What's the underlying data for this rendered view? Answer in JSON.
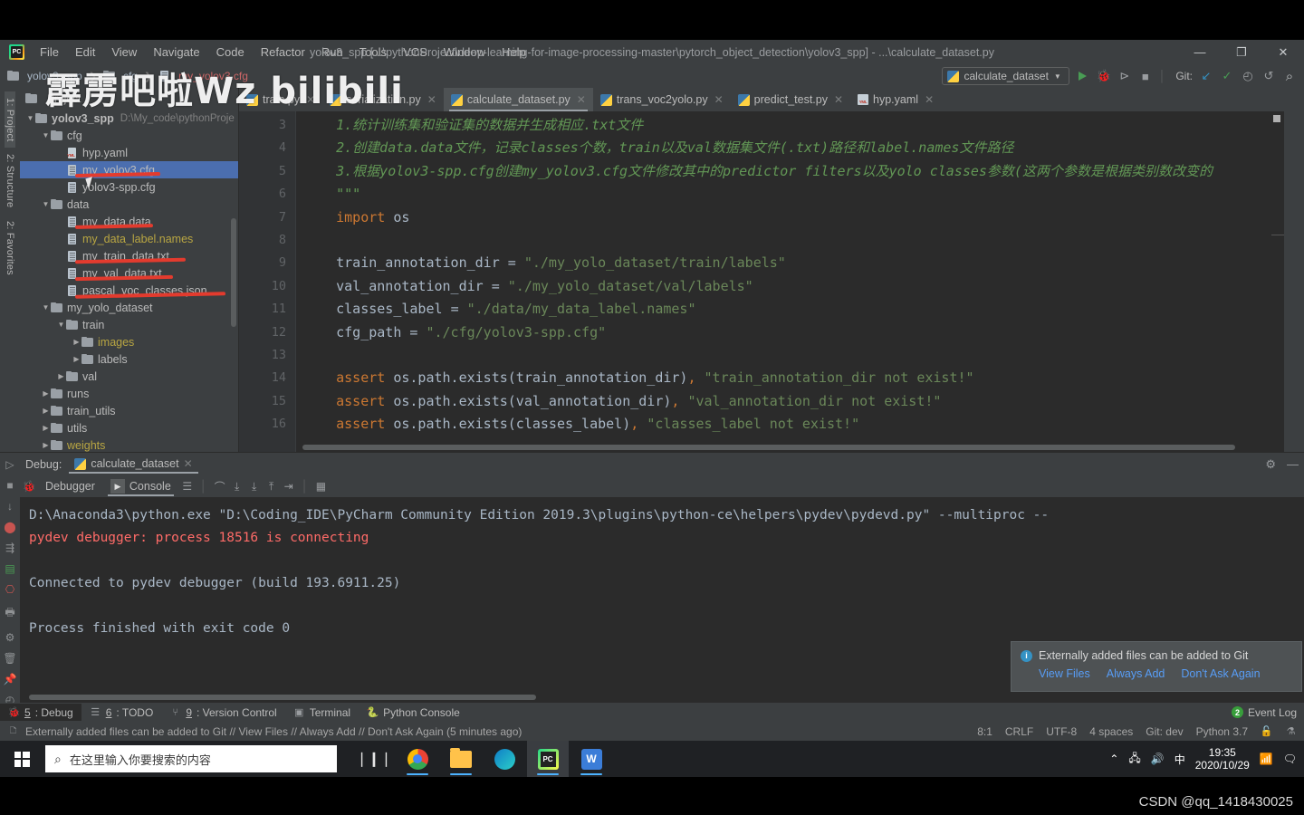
{
  "window": {
    "title": "yolov3_spp [...\\pythonProject\\deep-learning-for-image-processing-master\\pytorch_object_detection\\yolov3_spp] - ...\\calculate_dataset.py",
    "minimize": "—",
    "maximize": "❐",
    "close": "✕"
  },
  "menu": [
    "File",
    "Edit",
    "View",
    "Navigate",
    "Code",
    "Refactor",
    "Run",
    "Tools",
    "VCS",
    "Window",
    "Help"
  ],
  "breadcrumb": {
    "root": "yolov3_spp",
    "folder": "cfg",
    "file": "my_yolov3.cfg"
  },
  "toolbar": {
    "run_config": "calculate_dataset",
    "git_label": "Git:",
    "icons": [
      "run-icon",
      "debug-icon",
      "run-with-coverage-icon",
      "stop-icon",
      "git-update-icon",
      "git-commit-icon",
      "git-history-icon",
      "git-rollback-icon",
      "search-everywhere-icon"
    ]
  },
  "project_panel": {
    "title": "Project",
    "rail_labels": [
      "1: Project",
      "2: Structure",
      "2: Favorites"
    ],
    "tree": [
      {
        "depth": 0,
        "arrow": "down",
        "icon": "folder",
        "label": "yolov3_spp",
        "bold": true,
        "color": "white",
        "path": "D:\\My_code\\pythonProje",
        "strike": false
      },
      {
        "depth": 1,
        "arrow": "down",
        "icon": "folder",
        "label": "cfg",
        "color": "white",
        "strike": false
      },
      {
        "depth": 2,
        "arrow": "none",
        "icon": "yaml",
        "label": "hyp.yaml",
        "color": "white",
        "strike": false
      },
      {
        "depth": 2,
        "arrow": "none",
        "icon": "file",
        "label": "my_yolov3.cfg",
        "color": "white",
        "selected": true,
        "strike": true
      },
      {
        "depth": 2,
        "arrow": "none",
        "icon": "file",
        "label": "yolov3-spp.cfg",
        "color": "white",
        "strike": false
      },
      {
        "depth": 1,
        "arrow": "down",
        "icon": "folder",
        "label": "data",
        "color": "white",
        "strike": false
      },
      {
        "depth": 2,
        "arrow": "none",
        "icon": "file",
        "label": "my_data.data",
        "color": "white",
        "strike": true
      },
      {
        "depth": 2,
        "arrow": "none",
        "icon": "file",
        "label": "my_data_label.names",
        "color": "yellow",
        "strike": false
      },
      {
        "depth": 2,
        "arrow": "none",
        "icon": "file",
        "label": "my_train_data.txt",
        "color": "white",
        "strike": true
      },
      {
        "depth": 2,
        "arrow": "none",
        "icon": "file",
        "label": "my_val_data.txt",
        "color": "white",
        "strike": true
      },
      {
        "depth": 2,
        "arrow": "none",
        "icon": "file",
        "label": "pascal_voc_classes.json",
        "color": "white",
        "strike": true
      },
      {
        "depth": 1,
        "arrow": "down",
        "icon": "folder",
        "label": "my_yolo_dataset",
        "color": "white",
        "strike": false
      },
      {
        "depth": 2,
        "arrow": "down",
        "icon": "folder",
        "label": "train",
        "color": "white",
        "strike": false
      },
      {
        "depth": 3,
        "arrow": "right",
        "icon": "folder",
        "label": "images",
        "color": "yellow",
        "strike": false
      },
      {
        "depth": 3,
        "arrow": "right",
        "icon": "folder",
        "label": "labels",
        "color": "white",
        "strike": false
      },
      {
        "depth": 2,
        "arrow": "right",
        "icon": "folder",
        "label": "val",
        "color": "white",
        "strike": false
      },
      {
        "depth": 1,
        "arrow": "right",
        "icon": "folder",
        "label": "runs",
        "color": "white",
        "strike": false
      },
      {
        "depth": 1,
        "arrow": "right",
        "icon": "folder",
        "label": "train_utils",
        "color": "white",
        "strike": false
      },
      {
        "depth": 1,
        "arrow": "right",
        "icon": "folder",
        "label": "utils",
        "color": "white",
        "strike": false
      },
      {
        "depth": 1,
        "arrow": "right",
        "icon": "folder",
        "label": "weights",
        "color": "yellow",
        "strike": false
      }
    ]
  },
  "editor": {
    "tabs": [
      {
        "label": "train.py",
        "icon": "python-file-icon",
        "active": false
      },
      {
        "label": "serialization.py",
        "icon": "python-file-icon",
        "active": false
      },
      {
        "label": "calculate_dataset.py",
        "icon": "python-file-icon",
        "active": true
      },
      {
        "label": "trans_voc2yolo.py",
        "icon": "python-file-icon",
        "active": false
      },
      {
        "label": "predict_test.py",
        "icon": "python-file-icon",
        "active": false
      },
      {
        "label": "hyp.yaml",
        "icon": "yaml-file-icon",
        "active": false
      }
    ],
    "lines": [
      {
        "no": "3",
        "segments": [
          {
            "t": "    1.统计训练集和验证集的数据并生成相应.txt文件",
            "c": "comment"
          }
        ]
      },
      {
        "no": "4",
        "segments": [
          {
            "t": "    2.创建data.data文件，记录classes个数，train以及val数据集文件(.txt)路径和label.names文件路径",
            "c": "comment"
          }
        ]
      },
      {
        "no": "5",
        "segments": [
          {
            "t": "    3.根据yolov3-spp.cfg创建my_yolov3.cfg文件修改其中的predictor filters以及yolo classes参数(这两个参数是根据类别数改变的",
            "c": "comment"
          }
        ]
      },
      {
        "no": "6",
        "segments": [
          {
            "t": "    \"\"\"",
            "c": "comment"
          }
        ],
        "fold": true
      },
      {
        "no": "7",
        "segments": [
          {
            "t": "    import ",
            "c": "kw"
          },
          {
            "t": "os",
            "c": "var"
          }
        ]
      },
      {
        "no": "8",
        "segments": [
          {
            "t": "",
            "c": "var"
          }
        ]
      },
      {
        "no": "9",
        "segments": [
          {
            "t": "    train_annotation_dir ",
            "c": "var"
          },
          {
            "t": "= ",
            "c": "op"
          },
          {
            "t": "\"./my_yolo_dataset/train/labels\"",
            "c": "str"
          }
        ]
      },
      {
        "no": "10",
        "segments": [
          {
            "t": "    val_annotation_dir ",
            "c": "var"
          },
          {
            "t": "= ",
            "c": "op"
          },
          {
            "t": "\"./my_yolo_dataset/val/labels\"",
            "c": "str"
          }
        ]
      },
      {
        "no": "11",
        "segments": [
          {
            "t": "    classes_label ",
            "c": "var"
          },
          {
            "t": "= ",
            "c": "op"
          },
          {
            "t": "\"./data/my_data_label.names\"",
            "c": "str"
          }
        ]
      },
      {
        "no": "12",
        "segments": [
          {
            "t": "    cfg_path ",
            "c": "var"
          },
          {
            "t": "= ",
            "c": "op"
          },
          {
            "t": "\"./cfg/yolov3-spp.cfg\"",
            "c": "str"
          }
        ]
      },
      {
        "no": "13",
        "segments": [
          {
            "t": "",
            "c": "var"
          }
        ]
      },
      {
        "no": "14",
        "segments": [
          {
            "t": "    assert ",
            "c": "kw"
          },
          {
            "t": "os.path.exists(train_annotation_dir)",
            "c": "var"
          },
          {
            "t": ", ",
            "c": "kw"
          },
          {
            "t": "\"train_annotation_dir not exist!\"",
            "c": "str"
          }
        ]
      },
      {
        "no": "15",
        "segments": [
          {
            "t": "    assert ",
            "c": "kw"
          },
          {
            "t": "os.path.exists(val_annotation_dir)",
            "c": "var"
          },
          {
            "t": ", ",
            "c": "kw"
          },
          {
            "t": "\"val_annotation_dir not exist!\"",
            "c": "str"
          }
        ]
      },
      {
        "no": "16",
        "segments": [
          {
            "t": "    assert ",
            "c": "kw"
          },
          {
            "t": "os.path.exists(classes_label)",
            "c": "var"
          },
          {
            "t": ", ",
            "c": "kw"
          },
          {
            "t": "\"classes_label not exist!\"",
            "c": "str"
          }
        ]
      }
    ]
  },
  "debug": {
    "panel_label": "Debug:",
    "session_name": "calculate_dataset",
    "tabs": [
      {
        "label": "Debugger",
        "active": false
      },
      {
        "label": "Console",
        "active": true
      }
    ],
    "console_lines": [
      {
        "text": "D:\\Anaconda3\\python.exe \"D:\\Coding_IDE\\PyCharm Community Edition 2019.3\\plugins\\python-ce\\helpers\\pydev\\pydevd.py\" --multiproc --",
        "err": false
      },
      {
        "text": "pydev debugger: process 18516 is connecting",
        "err": true
      },
      {
        "text": "",
        "err": false
      },
      {
        "text": "Connected to pydev debugger (build 193.6911.25)",
        "err": false
      },
      {
        "text": "",
        "err": false
      },
      {
        "text": "Process finished with exit code 0",
        "err": false
      }
    ]
  },
  "balloon": {
    "message": "Externally added files can be added to Git",
    "links": [
      "View Files",
      "Always Add",
      "Don't Ask Again"
    ]
  },
  "toolwindows": [
    {
      "num": "5",
      "label": ": Debug",
      "icon": "bug-icon",
      "active": true
    },
    {
      "num": "6",
      "label": ": TODO",
      "icon": "list-icon",
      "active": false
    },
    {
      "num": "9",
      "label": ": Version Control",
      "icon": "branch-icon",
      "active": false
    },
    {
      "num": "",
      "label": "Terminal",
      "icon": "terminal-icon",
      "active": false
    },
    {
      "num": "",
      "label": "Python Console",
      "icon": "python-icon",
      "active": false
    }
  ],
  "event_log": {
    "label": "Event Log",
    "count": "2"
  },
  "statusbar": {
    "message": "Externally added files can be added to Git // View Files // Always Add // Don't Ask Again (5 minutes ago)",
    "caret": "8:1",
    "line_sep": "CRLF",
    "encoding": "UTF-8",
    "indent": "4 spaces",
    "branch": "Git: dev",
    "interpreter": "Python 3.7",
    "icons": [
      "lock-icon",
      "inspection-icon"
    ]
  },
  "taskbar": {
    "search_placeholder": "在这里输入你要搜索的内容",
    "apps": [
      {
        "name": "task-view-icon",
        "active": false
      },
      {
        "name": "chrome-icon",
        "active": false
      },
      {
        "name": "file-explorer-icon",
        "active": false
      },
      {
        "name": "edge-icon",
        "active": false
      },
      {
        "name": "pycharm-icon",
        "active": true
      },
      {
        "name": "wps-icon",
        "active": false
      }
    ],
    "tray": [
      "chevron-up-icon",
      "network-icon",
      "volume-icon",
      "ime-chinese"
    ],
    "ime": "中",
    "time": "19:35",
    "date": "2020/10/29",
    "right_icons": [
      "stats-icon",
      "notification-icon"
    ]
  },
  "watermarks": {
    "bilibili": "霹雳吧啦Wz bilibili",
    "csdn": "CSDN @qq_1418430025"
  }
}
